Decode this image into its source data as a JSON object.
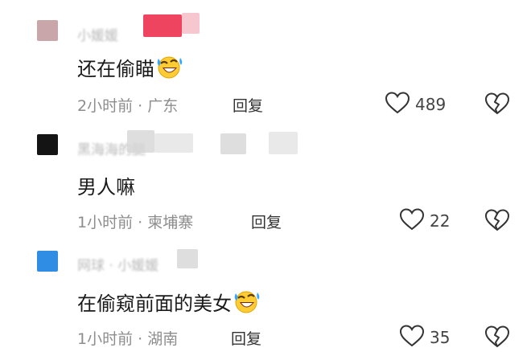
{
  "comments": [
    {
      "username": "小媛媛",
      "text": "还在偷瞄",
      "emoji": "rofl-emoji",
      "time": "2小时前",
      "dot": "·",
      "location": "广东",
      "reply_label": "回复",
      "likes": "489",
      "avatar_color": "#c9a6a9"
    },
    {
      "username": "黑海海的腿",
      "text": "男人嘛",
      "time": "1小时前",
      "dot": "·",
      "location": "柬埔寨",
      "reply_label": "回复",
      "likes": "22",
      "avatar_color": "#141414"
    },
    {
      "username": "网球 · 小媛媛",
      "text": "在偷窥前面的美女",
      "emoji": "rofl-emoji",
      "time": "1小时前",
      "dot": "·",
      "location": "湖南",
      "reply_label": "回复",
      "likes": "35",
      "avatar_color": "#2f8de4"
    }
  ],
  "icons": {
    "like": "heart-outline-icon",
    "dislike": "broken-heart-icon"
  },
  "colors": {
    "mosaic_red": "#ef4460",
    "mosaic_pink": "#f7c7d0",
    "mosaic_gray": "#d6d6d6"
  }
}
